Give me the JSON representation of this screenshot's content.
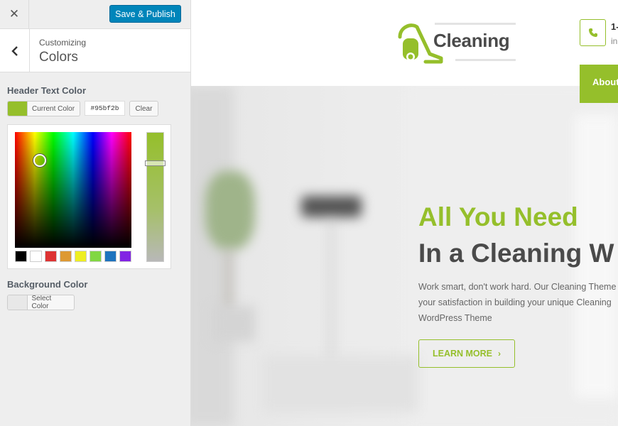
{
  "customizer": {
    "publish_label": "Save & Publish",
    "breadcrumb": "Customizing",
    "section_title": "Colors",
    "header_text_color": {
      "label": "Header Text Color",
      "button_label": "Current Color",
      "hex_value": "#95bf2b",
      "clear_label": "Clear",
      "current_color": "#95bf2b"
    },
    "palette": [
      "#000000",
      "#ffffff",
      "#dd3333",
      "#dd9933",
      "#eeee22",
      "#81d742",
      "#1e73be",
      "#8224e3"
    ],
    "background_color": {
      "label": "Background Color",
      "button_label": "Select Color",
      "current_color": "#e8e8e8"
    }
  },
  "site": {
    "logo_text": "Cleaning",
    "phone_number": "1-",
    "phone_sub": "in",
    "nav_item": "About",
    "hero": {
      "title_line1": "All You Need",
      "title_line2": "In a Cleaning W",
      "body": "Work smart, don't work hard. Our Cleaning Theme your satisfaction in building your unique Cleaning WordPress Theme",
      "button_label": "LEARN MORE"
    },
    "accent_color": "#95bf2b"
  }
}
